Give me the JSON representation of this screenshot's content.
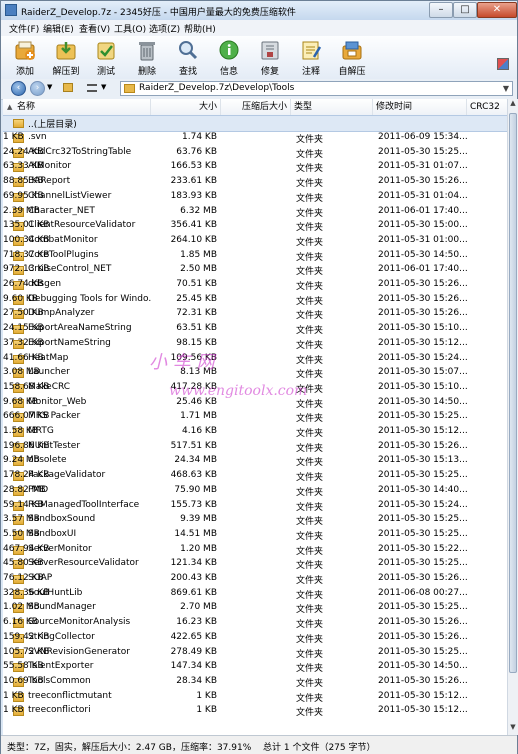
{
  "window": {
    "title": "RaiderZ_Develop.7z - 2345好压 - 中国用户量最大的免费压缩软件"
  },
  "menu": [
    "文件(F)",
    "编辑(E)",
    "查看(V)",
    "工具(O)",
    "选项(Z)",
    "帮助(H)"
  ],
  "toolbar": [
    {
      "label": "添加",
      "icon": "add-icon",
      "color": "#e58f1d"
    },
    {
      "label": "解压到",
      "icon": "extract-to-icon",
      "color": "#e0a636"
    },
    {
      "label": "测试",
      "icon": "test-icon",
      "color": "#4a9b3d"
    },
    {
      "label": "删除",
      "icon": "delete-icon",
      "color": "#6f7a85"
    },
    {
      "label": "查找",
      "icon": "search-icon",
      "color": "#6b8fb8"
    },
    {
      "label": "信息",
      "icon": "info-icon",
      "color": "#3f9b2d"
    },
    {
      "label": "修复",
      "icon": "repair-icon",
      "color": "#b04545"
    },
    {
      "label": "注释",
      "icon": "comment-icon",
      "color": "#d8a33a"
    },
    {
      "label": "自解压",
      "icon": "sfx-icon",
      "color": "#4f86c6"
    }
  ],
  "address": {
    "path": "RaiderZ_Develop.7z\\Develop\\Tools"
  },
  "columns": {
    "name": "名称",
    "size": "大小",
    "csize": "压缩后大小",
    "type": "类型",
    "modified": "修改时间",
    "crc": "CRC32"
  },
  "parent_row": {
    "name": "..(上层目录)"
  },
  "rows": [
    {
      "name": ".svn",
      "size": "1.74 KB",
      "csize": "1 KB",
      "type": "文件夹",
      "mod": "2011-06-09 15:34..."
    },
    {
      "name": "AddCrc32ToStringTable",
      "size": "63.76 KB",
      "csize": "24.24 KB",
      "type": "文件夹",
      "mod": "2011-05-30 15:25..."
    },
    {
      "name": "AIMonitor",
      "size": "166.53 KB",
      "csize": "63.33 KB",
      "type": "文件夹",
      "mod": "2011-05-31 01:07..."
    },
    {
      "name": "BAReport",
      "size": "233.61 KB",
      "csize": "88.85 KB",
      "type": "文件夹",
      "mod": "2011-05-30 15:26..."
    },
    {
      "name": "ChannelListViewer",
      "size": "183.93 KB",
      "csize": "69.95 KB",
      "type": "文件夹",
      "mod": "2011-05-31 01:04..."
    },
    {
      "name": "Character_NET",
      "size": "6.32 MB",
      "csize": "2.39 MB",
      "type": "文件夹",
      "mod": "2011-06-01 17:40..."
    },
    {
      "name": "ClientResourceValidator",
      "size": "356.41 KB",
      "csize": "135.01 KB",
      "type": "文件夹",
      "mod": "2011-05-30 15:00..."
    },
    {
      "name": "CombatMonitor",
      "size": "264.10 KB",
      "csize": "100.34 KB",
      "type": "文件夹",
      "mod": "2011-05-31 01:00..."
    },
    {
      "name": "CoreToolPlugins",
      "size": "1.85 MB",
      "csize": "718.37 KB",
      "type": "文件夹",
      "mod": "2011-05-30 14:50..."
    },
    {
      "name": "CruiseControl_NET",
      "size": "2.50 MB",
      "csize": "972.13 KB",
      "type": "文件夹",
      "mod": "2011-06-01 17:40..."
    },
    {
      "name": "ddsgen",
      "size": "70.51 KB",
      "csize": "26.74 KB",
      "type": "文件夹",
      "mod": "2011-05-30 15:26..."
    },
    {
      "name": "Debugging Tools for Windo...",
      "size": "25.45 KB",
      "csize": "9.60 KB",
      "type": "文件夹",
      "mod": "2011-05-30 15:26..."
    },
    {
      "name": "DumpAnalyzer",
      "size": "72.31 KB",
      "csize": "27.50 KB",
      "type": "文件夹",
      "mod": "2011-05-30 15:26..."
    },
    {
      "name": "ExportAreaNameString",
      "size": "63.51 KB",
      "csize": "24.15 KB",
      "type": "文件夹",
      "mod": "2011-05-30 15:10..."
    },
    {
      "name": "ExportNameString",
      "size": "98.15 KB",
      "csize": "37.32 KB",
      "type": "文件夹",
      "mod": "2011-05-30 15:12..."
    },
    {
      "name": "HeatMap",
      "size": "109.56 KB",
      "csize": "41.66 KB",
      "type": "文件夹",
      "mod": "2011-05-30 15:24..."
    },
    {
      "name": "Launcher",
      "size": "8.13 MB",
      "csize": "3.08 MB",
      "type": "文件夹",
      "mod": "2011-05-30 15:07..."
    },
    {
      "name": "MakeCRC",
      "size": "417.28 KB",
      "csize": "158.68 KB",
      "type": "文件夹",
      "mod": "2011-05-30 15:10..."
    },
    {
      "name": "Monitor_Web",
      "size": "25.46 KB",
      "csize": "9.68 KB",
      "type": "文件夹",
      "mod": "2011-05-30 14:50..."
    },
    {
      "name": "MRS Packer",
      "size": "1.71 MB",
      "csize": "666.07 KB",
      "type": "文件夹",
      "mod": "2011-05-30 15:25..."
    },
    {
      "name": "MRTG",
      "size": "4.16 KB",
      "csize": "1.58 KB",
      "type": "文件夹",
      "mod": "2011-05-30 15:12..."
    },
    {
      "name": "NUnitTester",
      "size": "517.51 KB",
      "csize": "196.86 KB",
      "type": "文件夹",
      "mod": "2011-05-30 15:26..."
    },
    {
      "name": "obsolete",
      "size": "24.34 MB",
      "csize": "9.24 MB",
      "type": "文件夹",
      "mod": "2011-05-30 15:13..."
    },
    {
      "name": "PackageValidator",
      "size": "468.63 KB",
      "csize": "178.24 KB",
      "type": "文件夹",
      "mod": "2011-05-30 15:25..."
    },
    {
      "name": "PMD",
      "size": "75.90 MB",
      "csize": "28.82 MB",
      "type": "文件夹",
      "mod": "2011-05-30 14:40..."
    },
    {
      "name": "RSManagedToolInterface",
      "size": "155.73 KB",
      "csize": "59.14 KB",
      "type": "文件夹",
      "mod": "2011-05-30 15:24..."
    },
    {
      "name": "SandboxSound",
      "size": "9.39 MB",
      "csize": "3.57 MB",
      "type": "文件夹",
      "mod": "2011-05-30 15:25..."
    },
    {
      "name": "SandboxUI",
      "size": "14.51 MB",
      "csize": "5.50 MB",
      "type": "文件夹",
      "mod": "2011-05-30 15:25..."
    },
    {
      "name": "ServerMonitor",
      "size": "1.20 MB",
      "csize": "467.94 KB",
      "type": "文件夹",
      "mod": "2011-05-30 15:22..."
    },
    {
      "name": "ServerResourceValidator",
      "size": "121.34 KB",
      "csize": "45.80 KB",
      "type": "文件夹",
      "mod": "2011-05-30 15:25..."
    },
    {
      "name": "SOAP",
      "size": "200.43 KB",
      "csize": "76.12 KB",
      "type": "文件夹",
      "mod": "2011-05-30 15:26..."
    },
    {
      "name": "SoulHuntLib",
      "size": "869.61 KB",
      "csize": "328.36 KB",
      "type": "文件夹",
      "mod": "2011-06-08 00:27..."
    },
    {
      "name": "SoundManager",
      "size": "2.70 MB",
      "csize": "1.02 MB",
      "type": "文件夹",
      "mod": "2011-05-30 15:25..."
    },
    {
      "name": "SourceMonitorAnalysis",
      "size": "16.23 KB",
      "csize": "6.16 KB",
      "type": "文件夹",
      "mod": "2011-05-30 15:26..."
    },
    {
      "name": "StringCollector",
      "size": "422.65 KB",
      "csize": "159.42 KB",
      "type": "文件夹",
      "mod": "2011-05-30 15:26..."
    },
    {
      "name": "SVNRevisionGenerator",
      "size": "278.49 KB",
      "csize": "105.72 KB",
      "type": "文件夹",
      "mod": "2011-05-30 15:25..."
    },
    {
      "name": "TalentExporter",
      "size": "147.34 KB",
      "csize": "55.58 KB",
      "type": "文件夹",
      "mod": "2011-05-30 14:50..."
    },
    {
      "name": "ToolsCommon",
      "size": "28.34 KB",
      "csize": "10.69 KB",
      "type": "文件夹",
      "mod": "2011-05-30 15:26..."
    },
    {
      "name": "treeconflictmutant",
      "size": "1 KB",
      "csize": "1 KB",
      "type": "文件夹",
      "mod": "2011-05-30 15:12..."
    },
    {
      "name": "treeconflictori",
      "size": "1 KB",
      "csize": "1 KB",
      "type": "文件夹",
      "mod": "2011-05-30 15:12..."
    }
  ],
  "status": {
    "left": "类型：7Z，固实，解压后大小：2.47 GB，压缩率：37.91%",
    "right": "总计 1 个文件（275 字节）"
  },
  "watermark": {
    "line1": "小  车  网",
    "line2": "www.engitoolx.com"
  }
}
